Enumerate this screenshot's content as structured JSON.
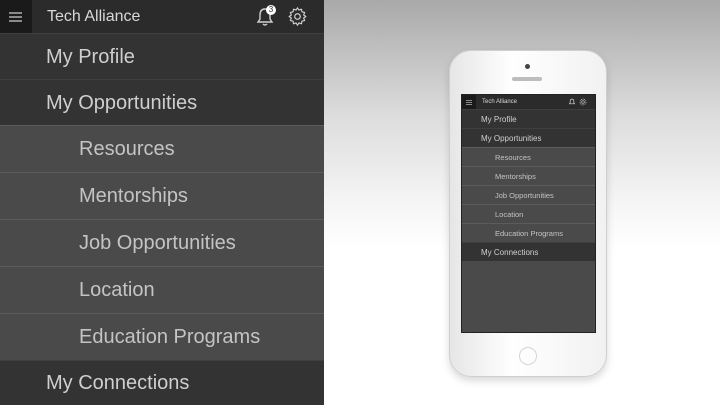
{
  "app": {
    "title": "Tech Alliance",
    "notification_count": "3",
    "menu": [
      {
        "label": "My Profile",
        "level": 1
      },
      {
        "label": "My Opportunities",
        "level": 1
      },
      {
        "label": "Resources",
        "level": 2
      },
      {
        "label": "Mentorships",
        "level": 2
      },
      {
        "label": "Job Opportunities",
        "level": 2
      },
      {
        "label": "Location",
        "level": 2
      },
      {
        "label": "Education Programs",
        "level": 2
      },
      {
        "label": "My Connections",
        "level": 1
      }
    ]
  },
  "icons": {
    "menu": "hamburger-icon",
    "notifications": "bell-icon",
    "settings": "gear-icon"
  },
  "colors": {
    "topbar": "#2b2b2b",
    "level1_bg": "#333333",
    "level2_bg": "#4a4a4a",
    "text": "#cfcfcf"
  }
}
